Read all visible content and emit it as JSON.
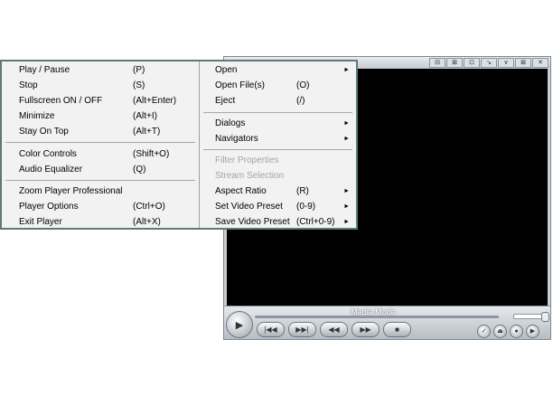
{
  "player": {
    "title_buttons": [
      "⊟",
      "⊠",
      "⊡",
      "↘",
      "∨",
      "⊠",
      "✕"
    ],
    "mode_label": "Media Mode",
    "play_glyph": "▶",
    "transport": [
      {
        "name": "prev-track-button",
        "glyph": "|◀◀"
      },
      {
        "name": "next-track-button",
        "glyph": "▶▶|"
      },
      {
        "name": "rewind-button",
        "glyph": "◀◀"
      },
      {
        "name": "fast-forward-button",
        "glyph": "▶▶"
      },
      {
        "name": "stop-button",
        "glyph": "■"
      }
    ],
    "right_buttons": [
      {
        "name": "check-button",
        "glyph": "✓"
      },
      {
        "name": "eject-button",
        "glyph": "⏏"
      },
      {
        "name": "playlist-button",
        "glyph": "●"
      },
      {
        "name": "frame-button",
        "glyph": "▶"
      }
    ]
  },
  "menu": {
    "left": [
      {
        "label": "Play / Pause",
        "shortcut": "(P)"
      },
      {
        "label": "Stop",
        "shortcut": "(S)"
      },
      {
        "label": "Fullscreen ON / OFF",
        "shortcut": "(Alt+Enter)"
      },
      {
        "label": "Minimize",
        "shortcut": "(Alt+I)"
      },
      {
        "label": "Stay On Top",
        "shortcut": "(Alt+T)"
      },
      {
        "label": "Color Controls",
        "shortcut": "(Shift+O)"
      },
      {
        "label": "Audio Equalizer",
        "shortcut": "(Q)"
      },
      {
        "label": "Zoom Player Professional",
        "shortcut": ""
      },
      {
        "label": "Player Options",
        "shortcut": "(Ctrl+O)"
      },
      {
        "label": "Exit Player",
        "shortcut": "(Alt+X)"
      }
    ],
    "right": [
      {
        "label": "Open",
        "shortcut": "",
        "submenu": true
      },
      {
        "label": "Open File(s)",
        "shortcut": "(O)"
      },
      {
        "label": "Eject",
        "shortcut": "(/)"
      },
      {
        "label": "Dialogs",
        "shortcut": "",
        "submenu": true
      },
      {
        "label": "Navigators",
        "shortcut": "",
        "submenu": true
      },
      {
        "label": "Filter Properties",
        "shortcut": "",
        "disabled": true
      },
      {
        "label": "Stream Selection",
        "shortcut": "",
        "disabled": true
      },
      {
        "label": "Aspect Ratio",
        "shortcut": "(R)",
        "submenu": true
      },
      {
        "label": "Set Video Preset",
        "shortcut": "(0-9)",
        "submenu": true
      },
      {
        "label": "Save Video Preset",
        "shortcut": "(Ctrl+0-9)",
        "submenu": true
      }
    ],
    "submenu_arrow": "►"
  }
}
